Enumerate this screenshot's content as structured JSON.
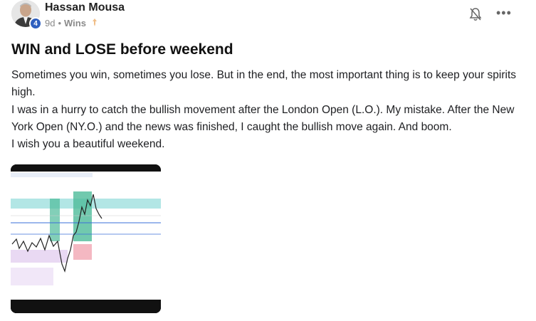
{
  "author": {
    "name": "Hassan Mousa",
    "level": "4",
    "avatar_icon": "user-avatar"
  },
  "meta": {
    "time": "9d",
    "separator": "•",
    "category": "Wins",
    "pinned_icon": "pin-icon"
  },
  "actions": {
    "notification_icon": "bell-off-icon",
    "more_label": "•••"
  },
  "post": {
    "title": "WIN and LOSE before weekend",
    "paragraphs": [
      "Sometimes you win, sometimes you lose. But in the end, the most important thing is to keep your spirits high.",
      "I was in a hurry to catch the bullish movement after the London Open (L.O.). My mistake. After the New York Open (NY.O.) and the news was finished, I caught the bullish move again. And boom.",
      "I wish you a beautiful weekend."
    ]
  },
  "attachment": {
    "type": "image",
    "description_icon": "trading-chart-thumbnail",
    "colors": {
      "frame": "#111111",
      "chart_bg": "#ffffff",
      "buy_zone": "#9fe0df",
      "profit_zone": "#4dbb9a",
      "loss_zone": "#f4b8c2",
      "fvg_zone": "#e9d9f3",
      "price_line": "#3a6fd8",
      "candles": "#222222"
    }
  }
}
